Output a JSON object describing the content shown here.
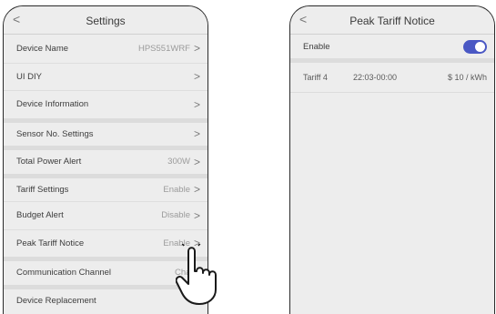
{
  "left_screen": {
    "back_glyph": "<",
    "title": "Settings",
    "rows": [
      {
        "label": "Device Name",
        "value": "HPS551WRF"
      },
      {
        "label": "UI DIY",
        "value": ""
      },
      {
        "label": "Device Information",
        "value": ""
      },
      {
        "label": "Sensor No. Settings",
        "value": ""
      },
      {
        "label": "Total Power Alert",
        "value": "300W"
      },
      {
        "label": "Tariff Settings",
        "value": "Enable"
      },
      {
        "label": "Budget Alert",
        "value": "Disable"
      },
      {
        "label": "Peak Tariff Notice",
        "value": "Enable"
      },
      {
        "label": "Communication Channel",
        "value": "Chann"
      },
      {
        "label": "Device Replacement",
        "value": ""
      }
    ],
    "chevron": ">"
  },
  "right_screen": {
    "back_glyph": "<",
    "title": "Peak Tariff Notice",
    "enable_label": "Enable",
    "enable_state": "on",
    "tariff": {
      "name": "Tariff 4",
      "time": "22:03-00:00",
      "price": "$ 10 / kWh"
    }
  },
  "colors": {
    "toggle_on": "#4a58c4",
    "panel_bg": "#ededed"
  },
  "icons": {
    "tap_gesture": "hand-pointer-icon"
  }
}
